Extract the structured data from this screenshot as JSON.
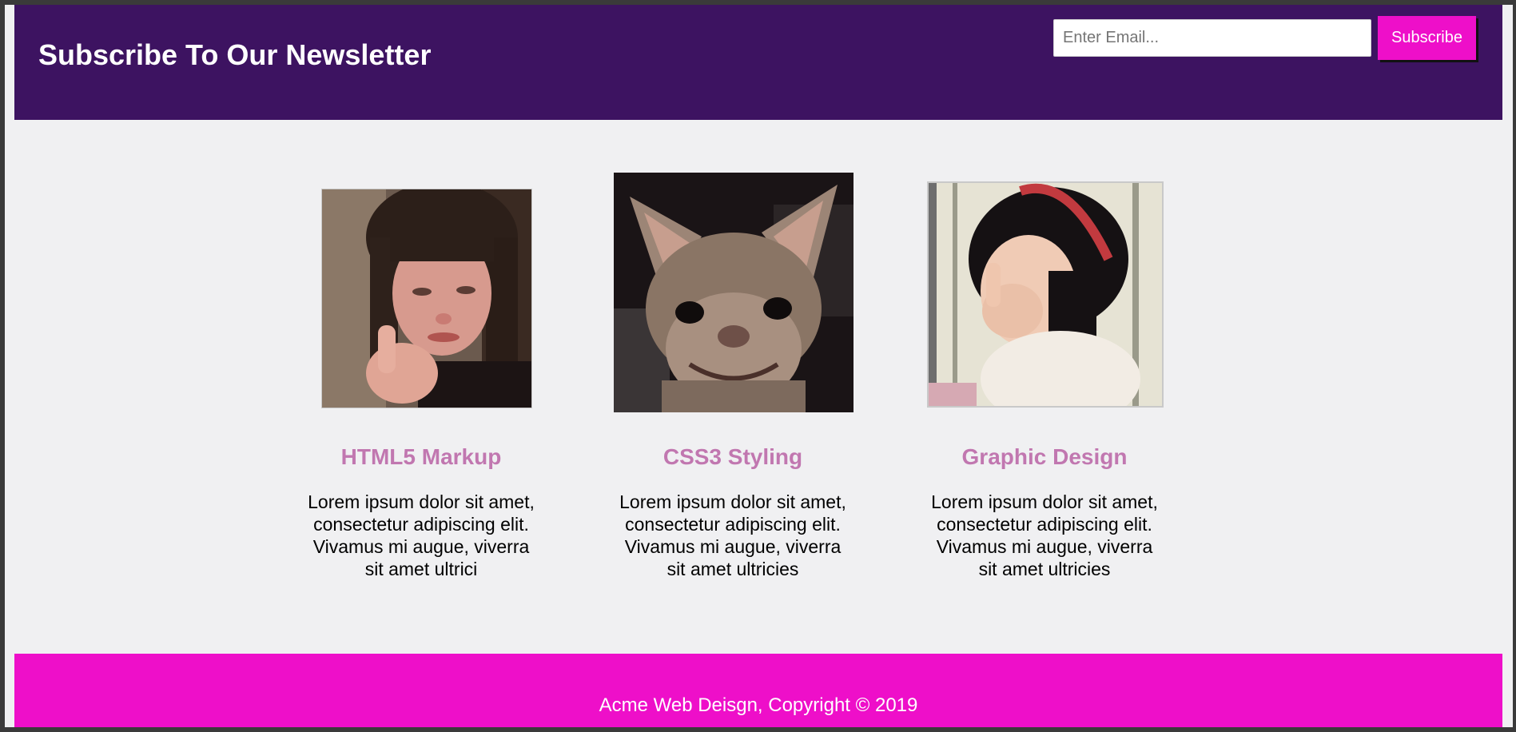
{
  "newsletter": {
    "title": "Subscribe To Our Newsletter",
    "email_placeholder": "Enter Email...",
    "email_value": "",
    "subscribe_label": "Subscribe"
  },
  "boxes": [
    {
      "title": "HTML5 Markup",
      "text": "Lorem ipsum dolor sit amet, consectetur adipiscing elit. Vivamus mi augue, viverra sit amet ultrici",
      "image": "photo-crying-girl-thumbs-up"
    },
    {
      "title": "CSS3 Styling",
      "text": "Lorem ipsum dolor sit amet, consectetur adipiscing elit. Vivamus mi augue, viverra sit amet ultricies",
      "image": "photo-smiling-chihuahua"
    },
    {
      "title": "Graphic Design",
      "text": "Lorem ipsum dolor sit amet, consectetur adipiscing elit. Vivamus mi augue, viverra sit amet ultricies",
      "image": "photo-child-rubbing-eye"
    }
  ],
  "footer": {
    "text": "Acme Web Deisgn, Copyright © 2019"
  },
  "colors": {
    "newsletter_background": "#3d1361",
    "accent_magenta": "#ee0fc9",
    "box_title": "#c177b0",
    "page_background": "#f0f0f2"
  }
}
